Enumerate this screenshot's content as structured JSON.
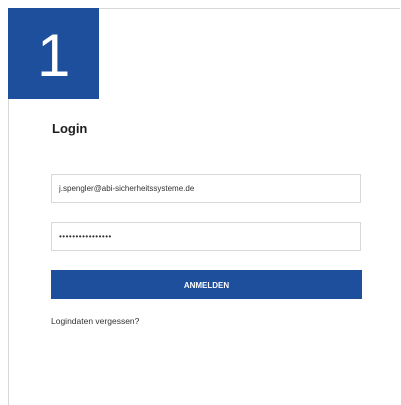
{
  "step": {
    "number": "1"
  },
  "login": {
    "title": "Login",
    "email_value": "j.spengler@abi-sicherheitssysteme.de",
    "password_masked": "••••••••••••••••",
    "submit_label": "ANMELDEN",
    "forgot_label": "Logindaten vergessen?"
  },
  "colors": {
    "brand_blue": "#1d4f9c",
    "border_gray": "#d8d8d8"
  }
}
